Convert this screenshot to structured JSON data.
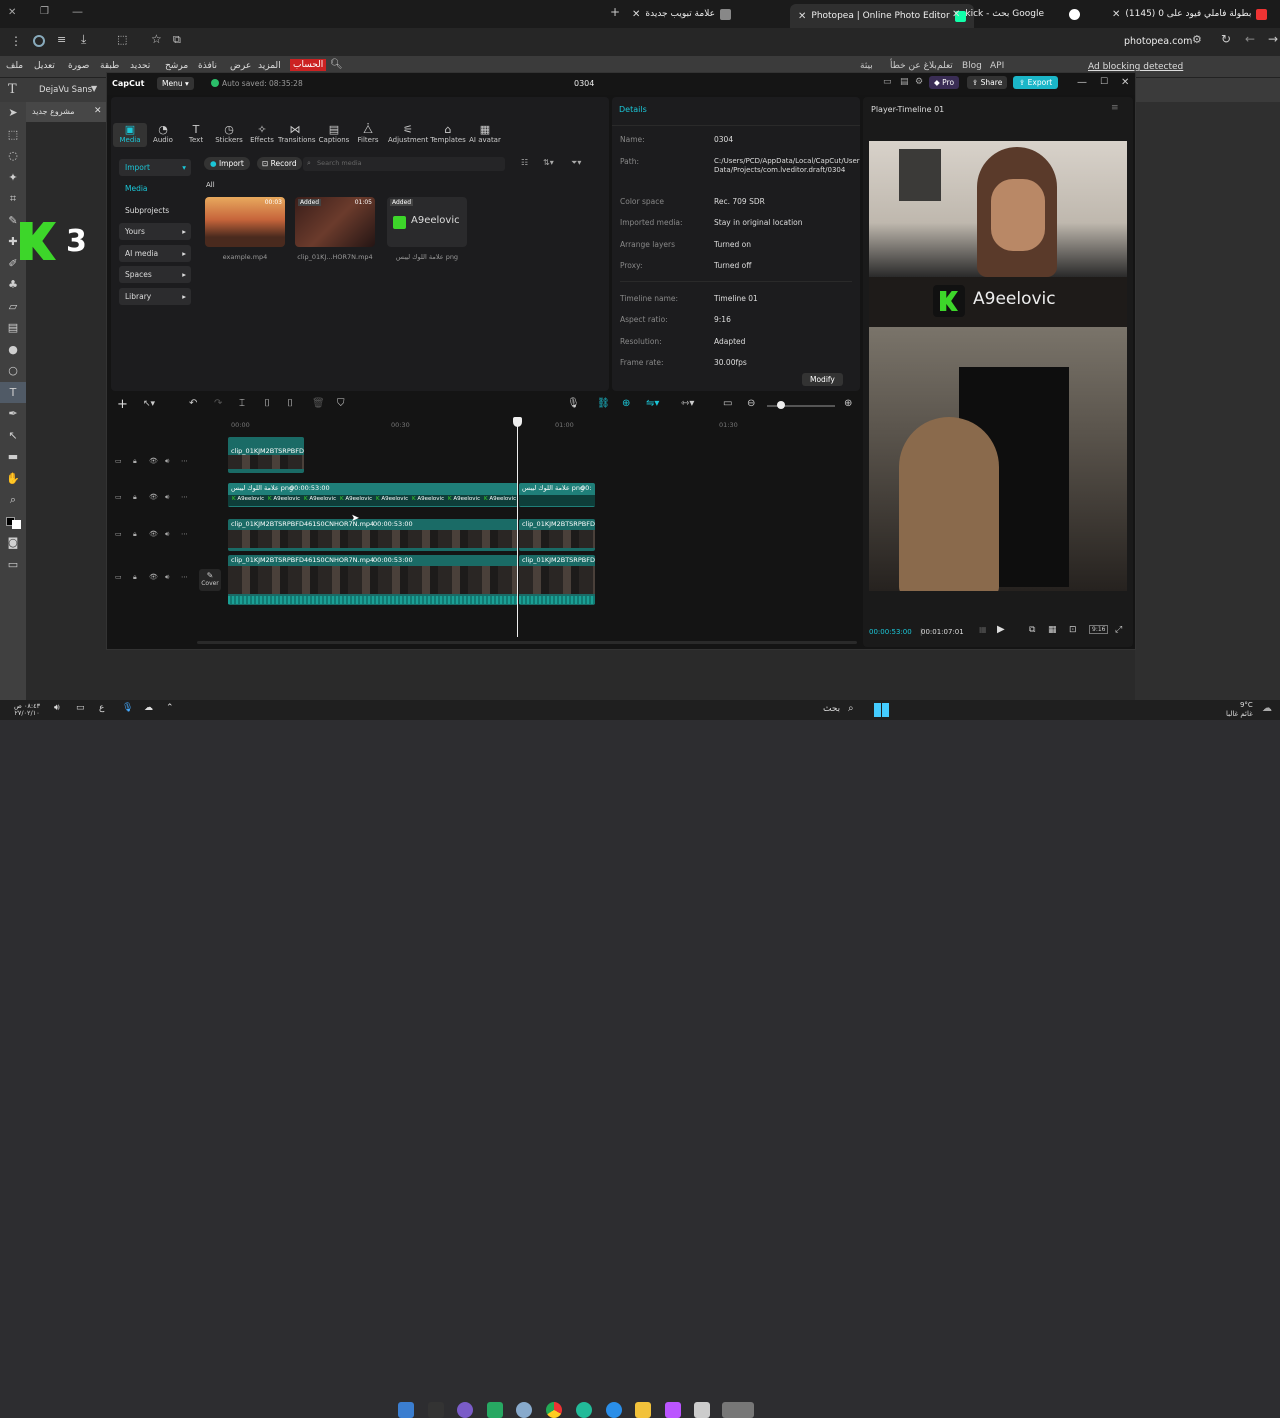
{
  "browser": {
    "tabs": [
      {
        "label": "(1145) بطولة فاملي فيود على 0",
        "color": "#e33"
      },
      {
        "label": "kick - بحث Google",
        "color": "#fff"
      },
      {
        "label": "Photopea | Online Photo Editor",
        "color": "#1fa"
      },
      {
        "label": "علامة تبويب جديدة",
        "color": "#888"
      }
    ],
    "url": "photopea.com"
  },
  "photopea": {
    "menu": [
      "ملف",
      "تعديل",
      "صورة",
      "طبقة",
      "تحديد",
      "مرشح",
      "نافذة",
      "عرض",
      "المزيد",
      "الحساب"
    ],
    "menu_right": [
      "بيثة",
      "بلاغ عن خطأ",
      "تعلم",
      "Blog",
      "API"
    ],
    "ad_notice": "Ad blocking detected",
    "font": "DejaVu Sans",
    "doc_tab": "مشروع جديد",
    "canvas_text": "3"
  },
  "capcut": {
    "brand": "CapCut",
    "menu_label": "Menu",
    "autosave": "Auto saved: 08:35:28",
    "project": "0304",
    "pro": "Pro",
    "share": "Share",
    "export": "Export",
    "tools": [
      "Media",
      "Audio",
      "Text",
      "Stickers",
      "Effects",
      "Transitions",
      "Captions",
      "Filters",
      "Adjustment",
      "Templates",
      "AI avatar"
    ],
    "sidebar": [
      "Import",
      "Media",
      "Subprojects",
      "Yours",
      "AI media",
      "Spaces",
      "Library"
    ],
    "import_btn": "Import",
    "record_btn": "Record",
    "search_placeholder": "Search media",
    "filter_all": "All",
    "media": [
      {
        "name": "example.mp4",
        "badge": "",
        "dur": "00:03"
      },
      {
        "name": "clip_01KJ...HOR7N.mp4",
        "badge": "Added",
        "dur": "01:05"
      },
      {
        "name": "علامة اللوك ليبس png",
        "badge": "Added",
        "dur": ""
      }
    ],
    "logo_text": "A9eelovic",
    "details_title": "Details",
    "details": [
      {
        "k": "Name:",
        "v": "0304"
      },
      {
        "k": "Path:",
        "v": "C:/Users/PCD/AppData/Local/CapCut/User Data/Projects/com.lveditor.draft/0304"
      },
      {
        "k": "Color space",
        "v": "Rec. 709 SDR"
      },
      {
        "k": "Imported media:",
        "v": "Stay in original location"
      },
      {
        "k": "Arrange layers",
        "v": "Turned on"
      },
      {
        "k": "Proxy:",
        "v": "Turned off"
      },
      {
        "k": "Timeline name:",
        "v": "Timeline 01"
      },
      {
        "k": "Aspect ratio:",
        "v": "9:16"
      },
      {
        "k": "Resolution:",
        "v": "Adapted"
      },
      {
        "k": "Frame rate:",
        "v": "30.00fps"
      }
    ],
    "modify": "Modify",
    "player_title": "Player-Timeline 01",
    "time_current": "00:00:53:00",
    "time_total": "00:01:07:01",
    "ratio": "9:16",
    "ruler": [
      "00:00",
      "00:30",
      "01:00",
      "01:30"
    ],
    "cover": "Cover",
    "clips": {
      "top": "clip_01KJM2BTSRPBFD",
      "png_a": "علامة اللوك ليبس png",
      "png_a_time": "00:00:53:00",
      "png_b": "علامة اللوك ليبس png",
      "png_b_time": "00:",
      "v1": "clip_01KJM2BTSRPBFD461S0CNHOR7N.mp4",
      "v1_time": "00:00:53:00",
      "v1b": "clip_01KJM2BTSRPBFD",
      "v2": "clip_01KJM2BTSRPBFD461S0CNHOR7N.mp4",
      "v2_time": "00:00:53:00",
      "v2b": "clip_01KJM2BTSRPBFD",
      "sticker": "A9eelovic"
    }
  },
  "taskbar": {
    "search": "بحث",
    "weather_temp": "9°C",
    "weather_desc": "غائم غالبا",
    "clock_time": "٠٨:٤٣ ص",
    "clock_date": "٢٧/٠٢/١٠"
  }
}
